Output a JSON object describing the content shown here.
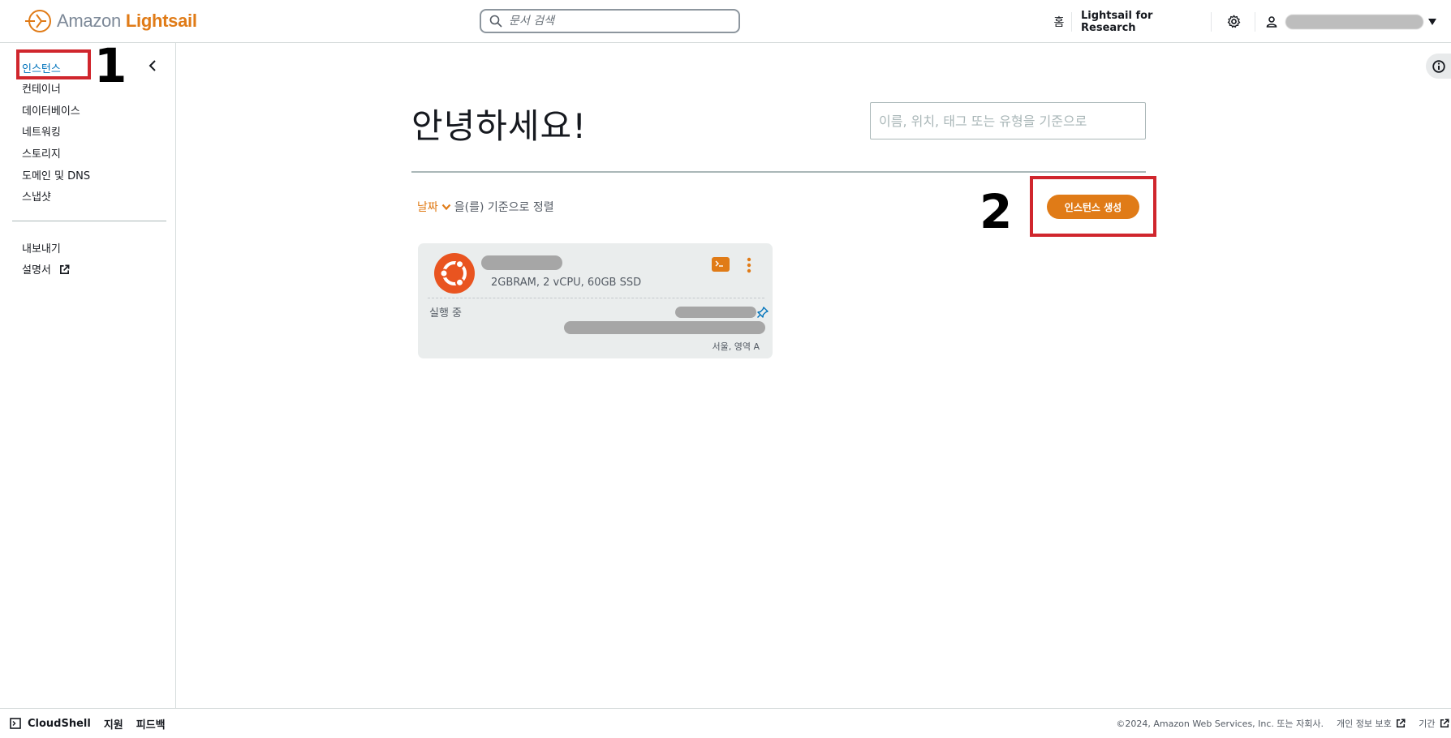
{
  "header": {
    "logo_text_1": "Amazon",
    "logo_text_2": "Lightsail",
    "search_placeholder": "문서 검색",
    "nav_home": "홈",
    "nav_research": "Lightsail for Research"
  },
  "sidebar": {
    "items": [
      {
        "label": "인스턴스",
        "active": true
      },
      {
        "label": "컨테이너"
      },
      {
        "label": "데이터베이스"
      },
      {
        "label": "네트워킹"
      },
      {
        "label": "스토리지"
      },
      {
        "label": "도메인 및 DNS"
      },
      {
        "label": "스냅샷"
      }
    ],
    "export_label": "내보내기",
    "docs_label": "설명서"
  },
  "annotations": {
    "step1": "1",
    "step2": "2"
  },
  "main": {
    "greeting": "안녕하세요!",
    "filter_placeholder": "이름, 위치, 태그 또는 유형을 기준으로",
    "sort_field": "날짜",
    "sort_suffix": "을(를) 기준으로 정렬",
    "create_button": "인스턴스 생성",
    "instance": {
      "spec": "2GBRAM, 2 vCPU, 60GB SSD",
      "status": "실행 중",
      "region": "서울, 영역 A"
    }
  },
  "footer": {
    "cloudshell": "CloudShell",
    "support": "지원",
    "feedback": "피드백",
    "copyright": "©2024, Amazon Web Services, Inc. 또는 자회사.",
    "privacy": "개인 정보 보호",
    "terms": "기간"
  },
  "colors": {
    "accent": "#e07b17",
    "link": "#0073bb",
    "annotation_red": "#d0262d",
    "ubuntu": "#e95420"
  }
}
